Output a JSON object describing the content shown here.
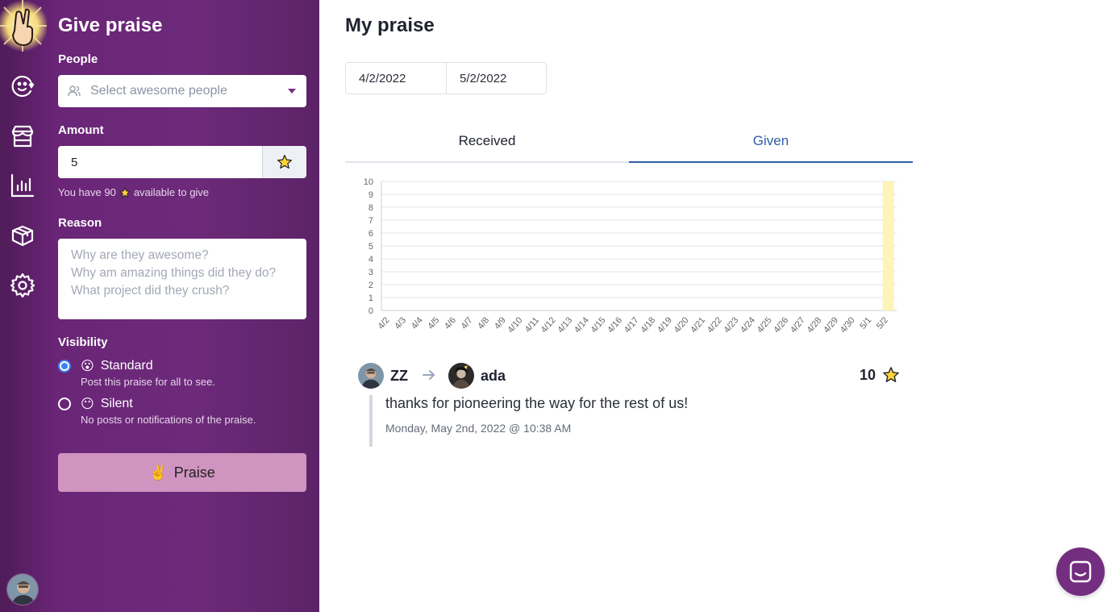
{
  "sidebar": {
    "title": "Give praise",
    "people": {
      "label": "People",
      "placeholder": "Select awesome people"
    },
    "amount": {
      "label": "Amount",
      "value": "5",
      "helper_prefix": "You have 90",
      "helper_suffix": "available to give"
    },
    "reason": {
      "label": "Reason",
      "placeholder": "Why are they awesome?\nWhy am amazing things did they do?\nWhat project did they crush?"
    },
    "visibility": {
      "label": "Visibility",
      "options": [
        {
          "emoji": "😮",
          "label": "Standard",
          "description": "Post this praise for all to see.",
          "checked": true
        },
        {
          "emoji": "😶",
          "label": "Silent",
          "description": "No posts or notifications of the praise.",
          "checked": false
        }
      ]
    },
    "praise_button": {
      "emoji": "✌",
      "label": "Praise"
    }
  },
  "main": {
    "title": "My praise",
    "date_from": "4/2/2022",
    "date_to": "5/2/2022",
    "tabs": [
      {
        "label": "Received",
        "active": false
      },
      {
        "label": "Given",
        "active": true
      }
    ],
    "entry": {
      "from": "ZZ",
      "to": "ada",
      "amount": "10",
      "message": "thanks for pioneering the way for the rest of us!",
      "time": "Monday, May 2nd, 2022 @ 10:38 AM"
    }
  },
  "colors": {
    "sidebar": "#6a2577",
    "accent": "#2d5ea8",
    "praise_button": "#cf95c0",
    "bar": "#fff4b8",
    "chat": "#742e80"
  },
  "chart_data": {
    "type": "bar",
    "categories": [
      "4/2",
      "4/3",
      "4/4",
      "4/5",
      "4/6",
      "4/7",
      "4/8",
      "4/9",
      "4/10",
      "4/11",
      "4/12",
      "4/13",
      "4/14",
      "4/15",
      "4/16",
      "4/17",
      "4/18",
      "4/19",
      "4/20",
      "4/21",
      "4/22",
      "4/23",
      "4/24",
      "4/25",
      "4/26",
      "4/27",
      "4/28",
      "4/29",
      "4/30",
      "5/1",
      "5/2"
    ],
    "values": [
      0,
      0,
      0,
      0,
      0,
      0,
      0,
      0,
      0,
      0,
      0,
      0,
      0,
      0,
      0,
      0,
      0,
      0,
      0,
      0,
      0,
      0,
      0,
      0,
      0,
      0,
      0,
      0,
      0,
      0,
      10
    ],
    "yticks": [
      "0",
      "1",
      "2",
      "3",
      "4",
      "5",
      "6",
      "7",
      "8",
      "9",
      "10"
    ],
    "ylim": [
      0,
      10
    ],
    "grid": true,
    "legend": "none"
  }
}
